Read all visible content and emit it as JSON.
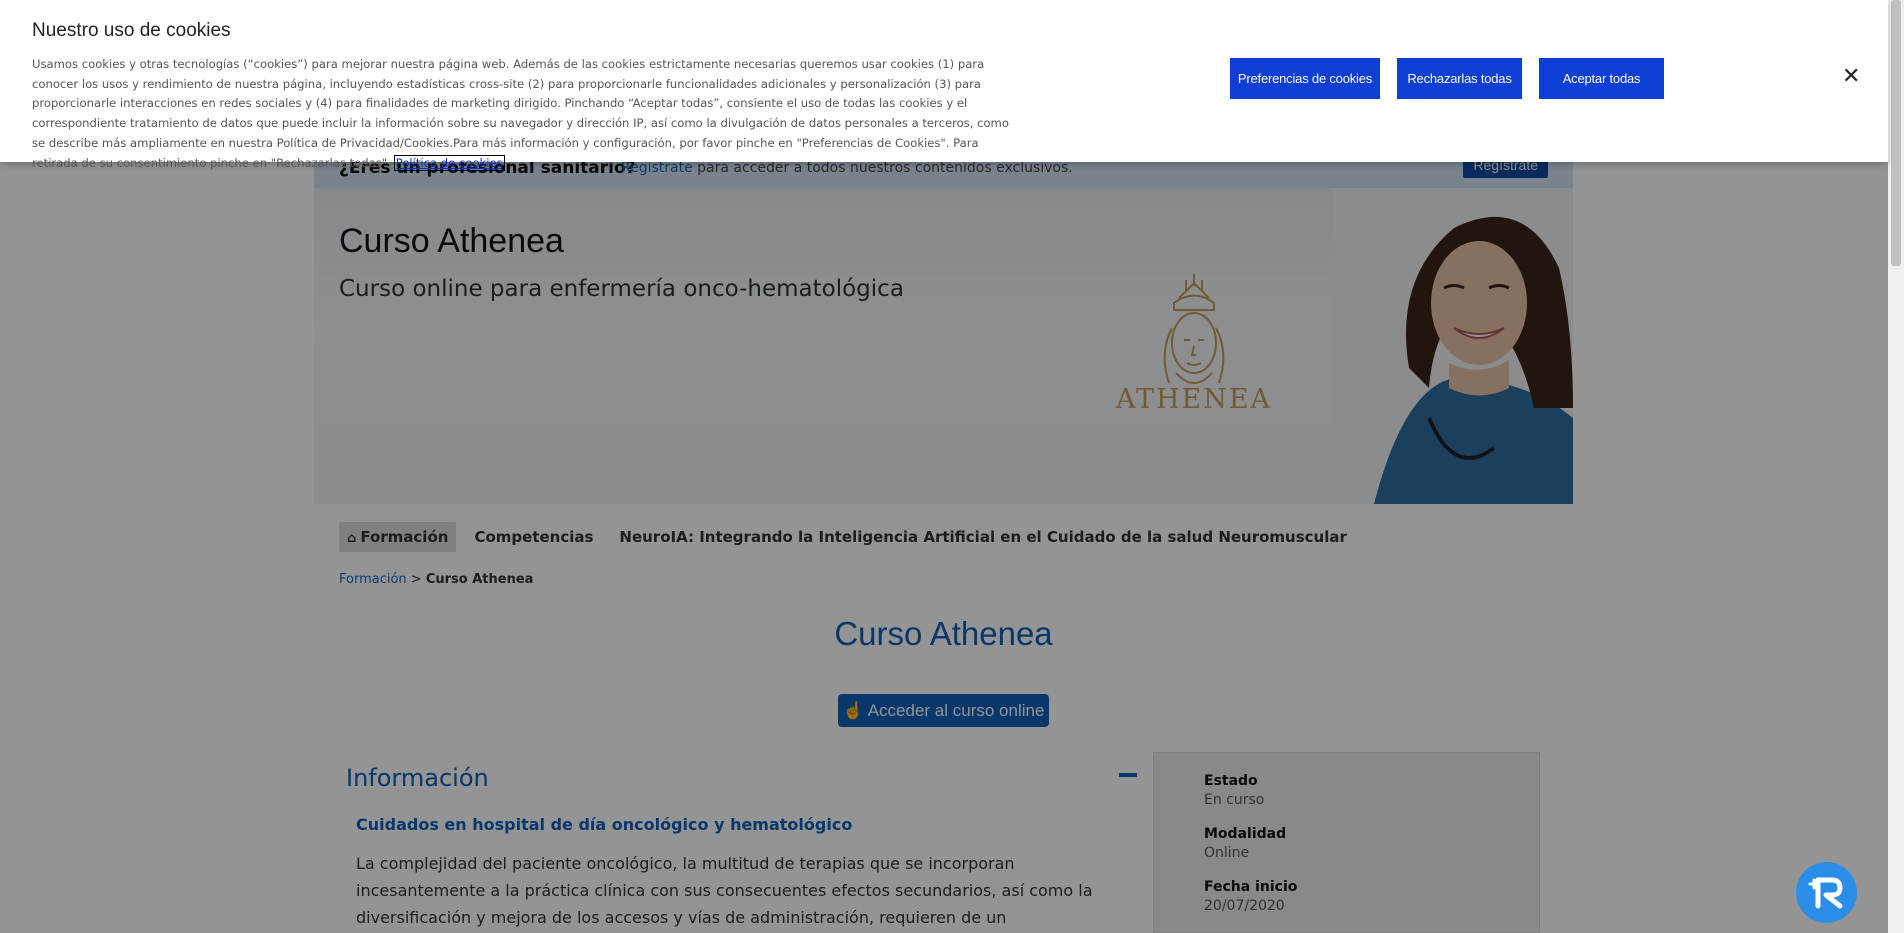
{
  "pro_bar": {
    "question": "¿Eres un profesional sanitario?",
    "link": "Regístrate",
    "text": " para acceder a todos nuestros contenidos exclusivos.",
    "button": "Regístrate"
  },
  "hero": {
    "title": "Curso Athenea",
    "subtitle": "Curso online para enfermería onco-hematológica",
    "logo_text": "ATHENEA"
  },
  "tabs": [
    {
      "label": "Formación",
      "active": true
    },
    {
      "label": "Competencias",
      "active": false
    },
    {
      "label": "NeuroIA: Integrando la Inteligencia Artificial en el Cuidado de la salud Neuromuscular",
      "active": false
    }
  ],
  "breadcrumb": {
    "link": "Formación",
    "separator": " > ",
    "current": "Curso Athenea"
  },
  "main": {
    "title": "Curso Athenea",
    "access_button": "Acceder al curso online"
  },
  "info": {
    "title": "Información",
    "subtitle": "Cuidados en hospital de día oncológico y hematológico",
    "body": "La complejidad del paciente oncológico, la multitud de terapias que se incorporan incesantemente a la práctica clínica con sus consecuentes efectos secundarios, así como la diversificación y mejora de los accesos y vías de administración, requieren de un entrenamiento y actualización constantes."
  },
  "side": [
    {
      "label": "Estado",
      "value": "En curso"
    },
    {
      "label": "Modalidad",
      "value": "Online"
    },
    {
      "label": "Fecha inicio",
      "value": "20/07/2020"
    }
  ],
  "cookie": {
    "title": "Nuestro uso de cookies",
    "text": "Usamos cookies y otras tecnologías (“cookies”) para mejorar nuestra página web. Además de las cookies estrictamente necesarias queremos usar cookies (1) para conocer los usos y rendimiento de nuestra página, incluyendo estadísticas cross-site (2) para proporcionarle funcionalidades adicionales y personalización (3) para proporcionarle interacciones en redes sociales y (4) para finalidades de marketing dirigido. Pinchando “Aceptar todas”, consiente el uso de todas las cookies y el correspondiente tratamiento de datos que puede incluir la información sobre su navegador y dirección IP, así como la divulgación de datos personales a terceros, como se describe más ampliamente en nuestra Política de Privacidad/Cookies.Para más información y configuración, por favor pinche en \"Preferencias de Cookies\". Para retirada de su consentimiento pinche en \"Rechazarlas todas\".",
    "policy_link": "Política de cookies",
    "btn_prefs": "Preferencias de cookies",
    "btn_reject": "Rechazarlas todas",
    "btn_accept": "Aceptar todas",
    "close": "✕"
  },
  "colors": {
    "brand_blue": "#0d5fb8",
    "cookie_button": "#0d3ed6",
    "chat_button": "#2a8ee8"
  },
  "icons": [
    "home-icon",
    "pointer-hand-icon",
    "minus-icon",
    "close-icon",
    "chat-bot-icon"
  ]
}
